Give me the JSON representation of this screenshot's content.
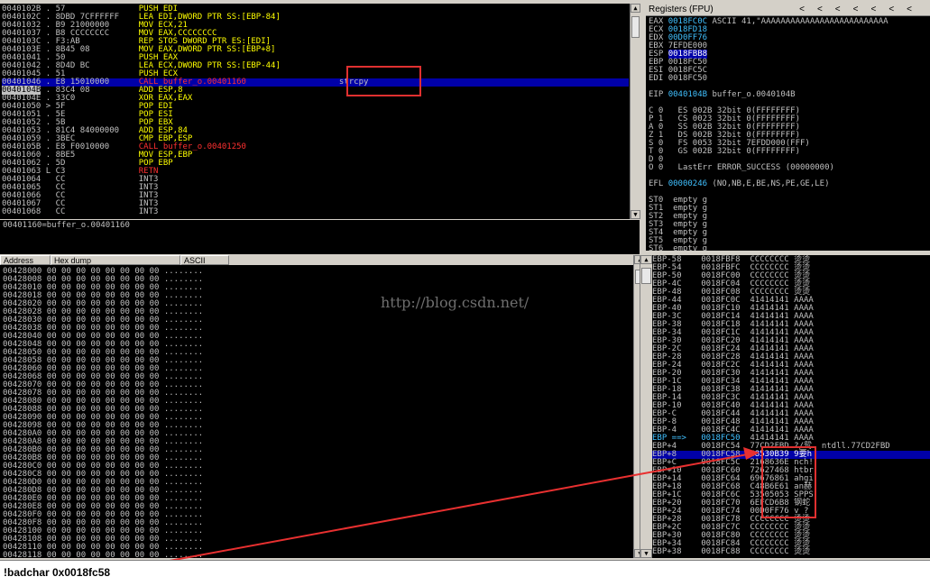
{
  "disasm": {
    "lines": [
      {
        "addr": "0040102B",
        "mark": " . ",
        "hex": "57",
        "asm": "PUSH EDI",
        "color": "yellow"
      },
      {
        "addr": "0040102C",
        "mark": " . ",
        "hex": "8DBD 7CFFFFFF",
        "asm": "LEA EDI,DWORD PTR SS:[EBP-84]",
        "color": "yellow"
      },
      {
        "addr": "00401032",
        "mark": " . ",
        "hex": "B9 21000000",
        "asm": "MOV ECX,21",
        "color": "yellow"
      },
      {
        "addr": "00401037",
        "mark": " . ",
        "hex": "B8 CCCCCCCC",
        "asm": "MOV EAX,CCCCCCCC",
        "color": "yellow"
      },
      {
        "addr": "0040103C",
        "mark": " . ",
        "hex": "F3:AB",
        "asm": "REP STOS DWORD PTR ES:[EDI]",
        "color": "yellow"
      },
      {
        "addr": "0040103E",
        "mark": " . ",
        "hex": "8B45 08",
        "asm": "MOV EAX,DWORD PTR SS:[EBP+8]",
        "color": "yellow"
      },
      {
        "addr": "00401041",
        "mark": " . ",
        "hex": "50",
        "asm": "PUSH EAX",
        "color": "yellow"
      },
      {
        "addr": "00401042",
        "mark": " . ",
        "hex": "8D4D BC",
        "asm": "LEA ECX,DWORD PTR SS:[EBP-44]",
        "color": "yellow"
      },
      {
        "addr": "00401045",
        "mark": " . ",
        "hex": "51",
        "asm": "PUSH ECX",
        "color": "yellow"
      },
      {
        "addr": "00401046",
        "mark": " . ",
        "hex": "E8 15010000",
        "asm": "CALL buffer_o.00401160",
        "color": "red",
        "comment": "strcpy",
        "highlight": true
      },
      {
        "addr": "0040104B",
        "mark": " . ",
        "hex": "83C4 08",
        "asm": "ADD ESP,8",
        "color": "yellow",
        "selected": true
      },
      {
        "addr": "0040104E",
        "mark": " . ",
        "hex": "33C0",
        "asm": "XOR EAX,EAX",
        "color": "yellow"
      },
      {
        "addr": "00401050",
        "mark": " > ",
        "hex": "5F",
        "asm": "POP EDI",
        "color": "yellow"
      },
      {
        "addr": "00401051",
        "mark": " . ",
        "hex": "5E",
        "asm": "POP ESI",
        "color": "yellow"
      },
      {
        "addr": "00401052",
        "mark": " . ",
        "hex": "5B",
        "asm": "POP EBX",
        "color": "yellow"
      },
      {
        "addr": "00401053",
        "mark": " . ",
        "hex": "81C4 84000000",
        "asm": "ADD ESP,84",
        "color": "yellow"
      },
      {
        "addr": "00401059",
        "mark": " . ",
        "hex": "3BEC",
        "asm": "CMP EBP,ESP",
        "color": "yellow"
      },
      {
        "addr": "0040105B",
        "mark": " . ",
        "hex": "E8 F0010000",
        "asm": "CALL buffer_o.00401250",
        "color": "red"
      },
      {
        "addr": "00401060",
        "mark": " . ",
        "hex": "8BE5",
        "asm": "MOV ESP,EBP",
        "color": "yellow"
      },
      {
        "addr": "00401062",
        "mark": " . ",
        "hex": "5D",
        "asm": "POP EBP",
        "color": "yellow"
      },
      {
        "addr": "00401063",
        "mark": " L ",
        "hex": "C3",
        "asm": "RETN",
        "color": "red"
      },
      {
        "addr": "00401064",
        "mark": "   ",
        "hex": "CC",
        "asm": "INT3",
        "color": "gray"
      },
      {
        "addr": "00401065",
        "mark": "   ",
        "hex": "CC",
        "asm": "INT3",
        "color": "gray"
      },
      {
        "addr": "00401066",
        "mark": "   ",
        "hex": "CC",
        "asm": "INT3",
        "color": "gray"
      },
      {
        "addr": "00401067",
        "mark": "   ",
        "hex": "CC",
        "asm": "INT3",
        "color": "gray"
      },
      {
        "addr": "00401068",
        "mark": "   ",
        "hex": "CC",
        "asm": "INT3",
        "color": "gray"
      }
    ],
    "info": "00401160=buffer_o.00401160"
  },
  "registers": {
    "title": "Registers (FPU)",
    "title_buttons": [
      "<",
      "<",
      "<",
      "<",
      "<",
      "<",
      "<"
    ],
    "lines": [
      {
        "name": "EAX",
        "val": "0018FC0C",
        "rest": " ASCII 41,\"AAAAAAAAAAAAAAAAAAAAAAAAAA"
      },
      {
        "name": "ECX",
        "val": "0018FD18",
        "rest": ""
      },
      {
        "name": "EDX",
        "val": "00D0FF76",
        "rest": ""
      },
      {
        "name": "EBX",
        "val": "7EFDE000",
        "rest": "",
        "plain": true
      },
      {
        "name": "ESP",
        "val": "0018FBB8",
        "rest": "",
        "boxed": true
      },
      {
        "name": "EBP",
        "val": "0018FC50",
        "rest": "",
        "plain": true
      },
      {
        "name": "ESI",
        "val": "0018FC5C",
        "rest": "",
        "plain": true
      },
      {
        "name": "EDI",
        "val": "0018FC50",
        "rest": "",
        "plain": true
      },
      {
        "name": "",
        "val": "",
        "rest": ""
      },
      {
        "name": "EIP",
        "val": "0040104B",
        "rest": " buffer_o.0040104B"
      },
      {
        "name": "",
        "val": "",
        "rest": ""
      },
      {
        "name": "C 0",
        "val": "",
        "rest": "  ES 002B 32bit 0(FFFFFFFF)"
      },
      {
        "name": "P 1",
        "val": "",
        "rest": "  CS 0023 32bit 0(FFFFFFFF)"
      },
      {
        "name": "A 0",
        "val": "",
        "rest": "  SS 002B 32bit 0(FFFFFFFF)"
      },
      {
        "name": "Z 1",
        "val": "",
        "rest": "  DS 002B 32bit 0(FFFFFFFF)"
      },
      {
        "name": "S 0",
        "val": "",
        "rest": "  FS 0053 32bit 7EFDD000(FFF)"
      },
      {
        "name": "T 0",
        "val": "",
        "rest": "  GS 002B 32bit 0(FFFFFFFF)"
      },
      {
        "name": "D 0",
        "val": "",
        "rest": ""
      },
      {
        "name": "O 0",
        "val": "",
        "rest": "  LastErr ERROR_SUCCESS (00000000)"
      },
      {
        "name": "",
        "val": "",
        "rest": ""
      },
      {
        "name": "EFL",
        "val": "00000246",
        "rest": " (NO,NB,E,BE,NS,PE,GE,LE)"
      },
      {
        "name": "",
        "val": "",
        "rest": ""
      },
      {
        "name": "ST0",
        "val": "",
        "rest": " empty g"
      },
      {
        "name": "ST1",
        "val": "",
        "rest": " empty g"
      },
      {
        "name": "ST2",
        "val": "",
        "rest": " empty g"
      },
      {
        "name": "ST3",
        "val": "",
        "rest": " empty g"
      },
      {
        "name": "ST4",
        "val": "",
        "rest": " empty g"
      },
      {
        "name": "ST5",
        "val": "",
        "rest": " empty g"
      },
      {
        "name": "ST6",
        "val": "",
        "rest": " empty g"
      },
      {
        "name": "ST7",
        "val": "",
        "rest": " empty g"
      },
      {
        "name": "",
        "val": "",
        "rest": "            3 2 1 0      E S P U O Z D I"
      }
    ]
  },
  "dump": {
    "headers": [
      "Address",
      "Hex dump",
      "ASCII"
    ],
    "start_addrs": [
      "00428000",
      "00428008",
      "00428010",
      "00428018",
      "00428020",
      "00428028",
      "00428030",
      "00428038",
      "00428040",
      "00428048",
      "00428050",
      "00428058",
      "00428060",
      "00428068",
      "00428070",
      "00428078",
      "00428080",
      "00428088",
      "00428090",
      "00428098",
      "004280A0",
      "004280A8",
      "004280B0",
      "004280B8",
      "004280C0",
      "004280C8",
      "004280D0",
      "004280D8",
      "004280E0",
      "004280E8",
      "004280F0",
      "004280F8",
      "00428100",
      "00428108",
      "00428110",
      "00428118"
    ],
    "hex": "00 00 00 00 00 00 00 00",
    "ascii": "........"
  },
  "stack": {
    "rows": [
      {
        "off": "EBP-58",
        "addr": "0018FBF8",
        "val": "CCCCCCCC",
        "cmt": "烫烫"
      },
      {
        "off": "EBP-54",
        "addr": "0018FBFC",
        "val": "CCCCCCCC",
        "cmt": "烫烫"
      },
      {
        "off": "EBP-50",
        "addr": "0018FC00",
        "val": "CCCCCCCC",
        "cmt": "烫烫"
      },
      {
        "off": "EBP-4C",
        "addr": "0018FC04",
        "val": "CCCCCCCC",
        "cmt": "烫烫"
      },
      {
        "off": "EBP-48",
        "addr": "0018FC08",
        "val": "CCCCCCCC",
        "cmt": "烫烫"
      },
      {
        "off": "EBP-44",
        "addr": "0018FC0C",
        "val": "41414141",
        "cmt": "AAAA"
      },
      {
        "off": "EBP-40",
        "addr": "0018FC10",
        "val": "41414141",
        "cmt": "AAAA"
      },
      {
        "off": "EBP-3C",
        "addr": "0018FC14",
        "val": "41414141",
        "cmt": "AAAA"
      },
      {
        "off": "EBP-38",
        "addr": "0018FC18",
        "val": "41414141",
        "cmt": "AAAA"
      },
      {
        "off": "EBP-34",
        "addr": "0018FC1C",
        "val": "41414141",
        "cmt": "AAAA"
      },
      {
        "off": "EBP-30",
        "addr": "0018FC20",
        "val": "41414141",
        "cmt": "AAAA"
      },
      {
        "off": "EBP-2C",
        "addr": "0018FC24",
        "val": "41414141",
        "cmt": "AAAA"
      },
      {
        "off": "EBP-28",
        "addr": "0018FC28",
        "val": "41414141",
        "cmt": "AAAA"
      },
      {
        "off": "EBP-24",
        "addr": "0018FC2C",
        "val": "41414141",
        "cmt": "AAAA"
      },
      {
        "off": "EBP-20",
        "addr": "0018FC30",
        "val": "41414141",
        "cmt": "AAAA"
      },
      {
        "off": "EBP-1C",
        "addr": "0018FC34",
        "val": "41414141",
        "cmt": "AAAA"
      },
      {
        "off": "EBP-18",
        "addr": "0018FC38",
        "val": "41414141",
        "cmt": "AAAA"
      },
      {
        "off": "EBP-14",
        "addr": "0018FC3C",
        "val": "41414141",
        "cmt": "AAAA"
      },
      {
        "off": "EBP-10",
        "addr": "0018FC40",
        "val": "41414141",
        "cmt": "AAAA"
      },
      {
        "off": "EBP-C",
        "addr": "0018FC44",
        "val": "41414141",
        "cmt": "AAAA"
      },
      {
        "off": "EBP-8",
        "addr": "0018FC48",
        "val": "41414141",
        "cmt": "AAAA"
      },
      {
        "off": "EBP-4",
        "addr": "0018FC4C",
        "val": "41414141",
        "cmt": "AAAA"
      },
      {
        "off": "EBP ==>",
        "addr": "0018FC50",
        "val": "41414141",
        "cmt": "AAAA",
        "cyan": true
      },
      {
        "off": "EBP+4",
        "addr": "0018FC54",
        "val": "77CD2FBD",
        "cmt": "?/鸳  ntdll.77CD2FBD"
      },
      {
        "off": "EBP+8",
        "addr": "0018FC58",
        "val": "68530B39",
        "cmt": "9要h",
        "selected": true
      },
      {
        "off": "EBP+C",
        "addr": "0018FC5C",
        "val": "2168636E",
        "cmt": "nch!"
      },
      {
        "off": "EBP+10",
        "addr": "0018FC60",
        "val": "72627468",
        "cmt": "htbr"
      },
      {
        "off": "EBP+14",
        "addr": "0018FC64",
        "val": "69676861",
        "cmt": "ahgi"
      },
      {
        "off": "EBP+18",
        "addr": "0018FC68",
        "val": "C48B6E61",
        "cmt": "an赫"
      },
      {
        "off": "EBP+1C",
        "addr": "0018FC6C",
        "val": "53505053",
        "cmt": "SPPS"
      },
      {
        "off": "EBP+20",
        "addr": "0018FC70",
        "val": "6EFCD6B8",
        "cmt": "钢蛇"
      },
      {
        "off": "EBP+24",
        "addr": "0018FC74",
        "val": "00D0FF76",
        "cmt": "v ?"
      },
      {
        "off": "EBP+28",
        "addr": "0018FC78",
        "val": "CCCCCCCC",
        "cmt": "烫烫"
      },
      {
        "off": "EBP+2C",
        "addr": "0018FC7C",
        "val": "CCCCCCCC",
        "cmt": "烫烫"
      },
      {
        "off": "EBP+30",
        "addr": "0018FC80",
        "val": "CCCCCCCC",
        "cmt": "烫烫"
      },
      {
        "off": "EBP+34",
        "addr": "0018FC84",
        "val": "CCCCCCCC",
        "cmt": "烫烫"
      },
      {
        "off": "EBP+38",
        "addr": "0018FC88",
        "val": "CCCCCCCC",
        "cmt": "烫烫"
      }
    ]
  },
  "watermark": "http://blog.csdn.net/",
  "command": {
    "value": "!badchar 0x0018fc58"
  }
}
